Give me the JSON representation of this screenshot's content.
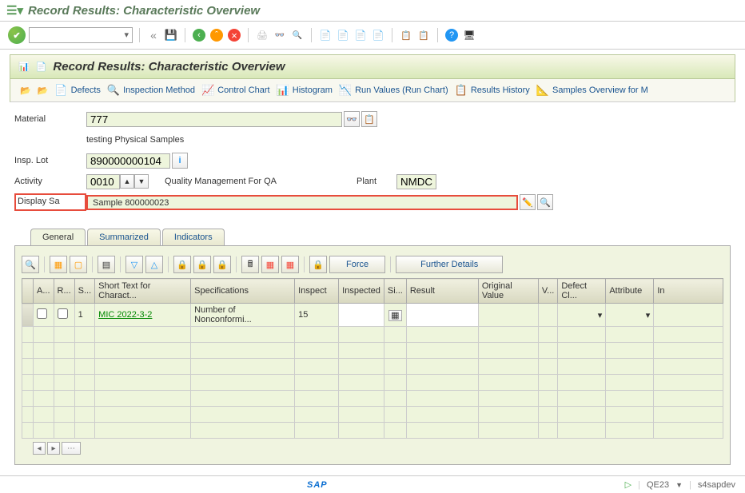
{
  "window": {
    "title": "Record Results: Characteristic Overview"
  },
  "panel": {
    "title": "Record Results: Characteristic Overview"
  },
  "subtoolbar": {
    "defects": "Defects",
    "inspection_method": "Inspection Method",
    "control_chart": "Control Chart",
    "histogram": "Histogram",
    "run_values": "Run Values (Run Chart)",
    "results_history": "Results History",
    "samples_overview": "Samples Overview for M"
  },
  "form": {
    "material_label": "Material",
    "material_value": "777",
    "material_desc": "testing Physical Samples",
    "insp_lot_label": "Insp. Lot",
    "insp_lot_value": "890000000104",
    "activity_label": "Activity",
    "activity_value": "0010",
    "activity_desc": "Quality Management For QA",
    "plant_label": "Plant",
    "plant_value": "NMDC",
    "display_sa_label": "Display Sa",
    "display_sa_value": "Sample 800000023"
  },
  "tabs": {
    "general": "General",
    "summarized": "Summarized",
    "indicators": "Indicators"
  },
  "grid_toolbar": {
    "force": "Force",
    "further_details": "Further Details"
  },
  "grid": {
    "headers": {
      "a": "A...",
      "r": "R...",
      "s": "S...",
      "short_text": "Short Text for Charact...",
      "specifications": "Specifications",
      "inspect": "Inspect",
      "inspected": "Inspected",
      "si": "Si...",
      "result": "Result",
      "original_value": "Original Value",
      "v": "V...",
      "defect_cl": "Defect Cl...",
      "attribute": "Attribute",
      "in": "In"
    },
    "rows": [
      {
        "s": "1",
        "short_text": "MIC 2022-3-2",
        "specifications": "Number of Nonconformi...",
        "inspect": "15"
      }
    ]
  },
  "status": {
    "tcode": "QE23",
    "system": "s4sapdev"
  }
}
